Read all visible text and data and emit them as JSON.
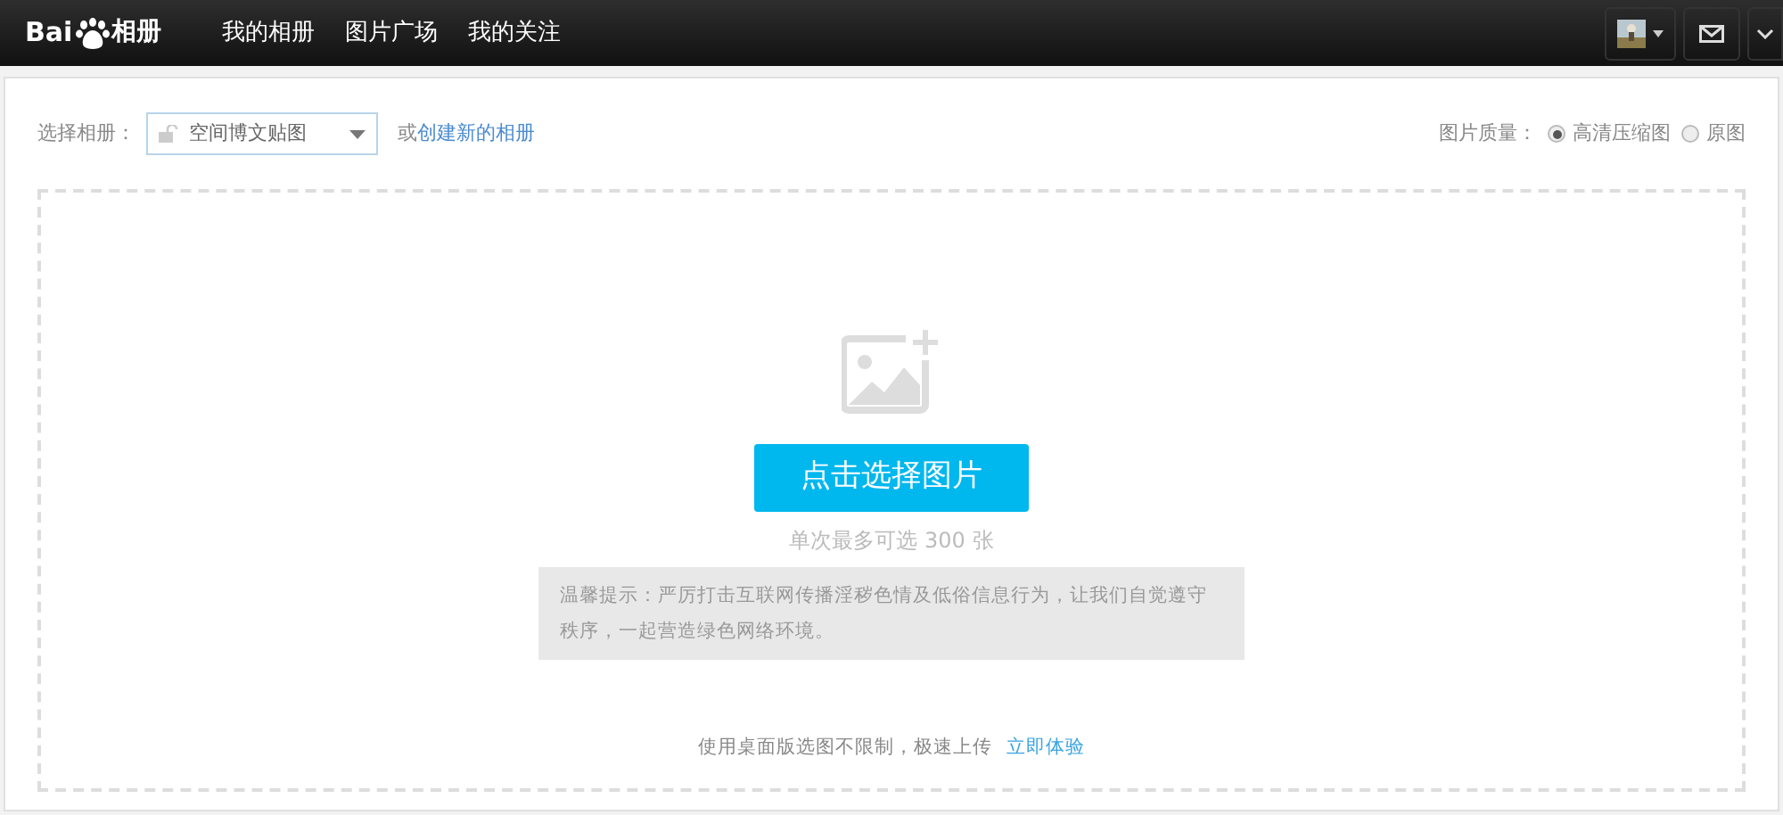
{
  "header": {
    "logo": {
      "left": "Bai",
      "right": "相册"
    },
    "nav": [
      {
        "label": "我的相册",
        "selected": false
      },
      {
        "label": "图片广场",
        "selected": false
      },
      {
        "label": "我的关注",
        "selected": false
      }
    ]
  },
  "toolbar": {
    "album_label": "选择相册：",
    "album_select": "空间博文贴图",
    "or_text": "或",
    "create_link": "创建新的相册",
    "quality_label": "图片质量：",
    "quality_options": [
      {
        "label": "高清压缩图",
        "selected": true
      },
      {
        "label": "原图",
        "selected": false
      }
    ]
  },
  "upload": {
    "button": "点击选择图片",
    "limit": "单次最多可选 300 张",
    "notice": "温馨提示：严厉打击互联网传播淫秽色情及低俗信息行为，让我们自觉遵守秩序，一起营造绿色网络环境。",
    "desktop_text": "使用桌面版选图不限制，极速上传",
    "desktop_link": "立即体验"
  }
}
